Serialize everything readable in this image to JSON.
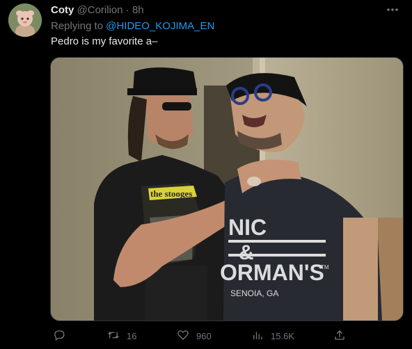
{
  "tweet": {
    "display_name": "Coty",
    "handle": "@Corilion",
    "separator": "·",
    "time": "8h",
    "replying_prefix": "Replying to ",
    "replying_to": "@HIDEO_KOJIMA_EN",
    "text": "Pedro is my favorite a–"
  },
  "image": {
    "shirt_left_print": "the stooges",
    "shirt_right_line1": "NIC",
    "shirt_right_line2": "&",
    "shirt_right_line3": "ORMAN'S",
    "shirt_right_tm": "TM",
    "shirt_right_line4": "SENOIA, GA"
  },
  "actions": {
    "reply_icon": "reply-icon",
    "retweet_icon": "retweet-icon",
    "retweets": "16",
    "like_icon": "heart-icon",
    "likes": "960",
    "views_icon": "views-icon",
    "views": "15.6K",
    "share_icon": "share-icon"
  },
  "colors": {
    "background": "#000000",
    "text_primary": "#e7e9ea",
    "text_secondary": "#71767b",
    "link": "#1d9bf0"
  }
}
